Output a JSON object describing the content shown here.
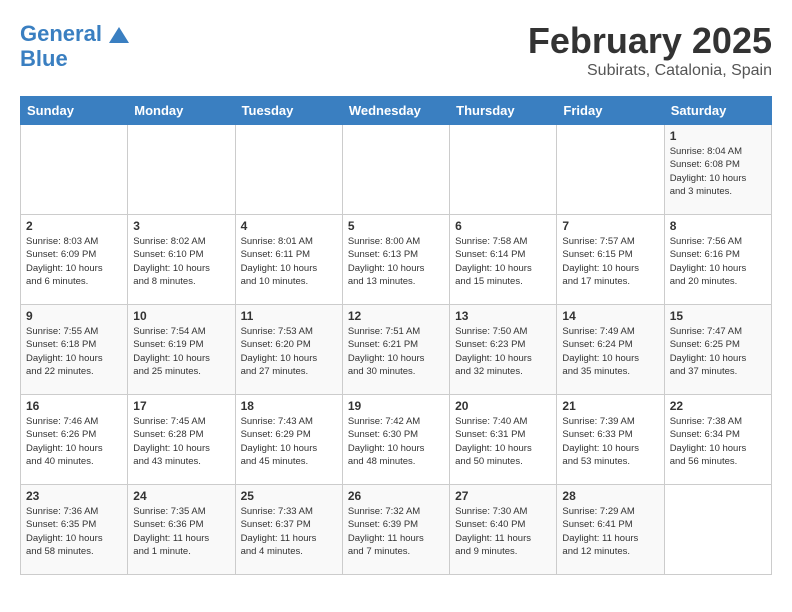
{
  "header": {
    "logo_line1": "General",
    "logo_line2": "Blue",
    "month": "February 2025",
    "location": "Subirats, Catalonia, Spain"
  },
  "weekdays": [
    "Sunday",
    "Monday",
    "Tuesday",
    "Wednesday",
    "Thursday",
    "Friday",
    "Saturday"
  ],
  "weeks": [
    [
      {
        "day": "",
        "info": ""
      },
      {
        "day": "",
        "info": ""
      },
      {
        "day": "",
        "info": ""
      },
      {
        "day": "",
        "info": ""
      },
      {
        "day": "",
        "info": ""
      },
      {
        "day": "",
        "info": ""
      },
      {
        "day": "1",
        "info": "Sunrise: 8:04 AM\nSunset: 6:08 PM\nDaylight: 10 hours\nand 3 minutes."
      }
    ],
    [
      {
        "day": "2",
        "info": "Sunrise: 8:03 AM\nSunset: 6:09 PM\nDaylight: 10 hours\nand 6 minutes."
      },
      {
        "day": "3",
        "info": "Sunrise: 8:02 AM\nSunset: 6:10 PM\nDaylight: 10 hours\nand 8 minutes."
      },
      {
        "day": "4",
        "info": "Sunrise: 8:01 AM\nSunset: 6:11 PM\nDaylight: 10 hours\nand 10 minutes."
      },
      {
        "day": "5",
        "info": "Sunrise: 8:00 AM\nSunset: 6:13 PM\nDaylight: 10 hours\nand 13 minutes."
      },
      {
        "day": "6",
        "info": "Sunrise: 7:58 AM\nSunset: 6:14 PM\nDaylight: 10 hours\nand 15 minutes."
      },
      {
        "day": "7",
        "info": "Sunrise: 7:57 AM\nSunset: 6:15 PM\nDaylight: 10 hours\nand 17 minutes."
      },
      {
        "day": "8",
        "info": "Sunrise: 7:56 AM\nSunset: 6:16 PM\nDaylight: 10 hours\nand 20 minutes."
      }
    ],
    [
      {
        "day": "9",
        "info": "Sunrise: 7:55 AM\nSunset: 6:18 PM\nDaylight: 10 hours\nand 22 minutes."
      },
      {
        "day": "10",
        "info": "Sunrise: 7:54 AM\nSunset: 6:19 PM\nDaylight: 10 hours\nand 25 minutes."
      },
      {
        "day": "11",
        "info": "Sunrise: 7:53 AM\nSunset: 6:20 PM\nDaylight: 10 hours\nand 27 minutes."
      },
      {
        "day": "12",
        "info": "Sunrise: 7:51 AM\nSunset: 6:21 PM\nDaylight: 10 hours\nand 30 minutes."
      },
      {
        "day": "13",
        "info": "Sunrise: 7:50 AM\nSunset: 6:23 PM\nDaylight: 10 hours\nand 32 minutes."
      },
      {
        "day": "14",
        "info": "Sunrise: 7:49 AM\nSunset: 6:24 PM\nDaylight: 10 hours\nand 35 minutes."
      },
      {
        "day": "15",
        "info": "Sunrise: 7:47 AM\nSunset: 6:25 PM\nDaylight: 10 hours\nand 37 minutes."
      }
    ],
    [
      {
        "day": "16",
        "info": "Sunrise: 7:46 AM\nSunset: 6:26 PM\nDaylight: 10 hours\nand 40 minutes."
      },
      {
        "day": "17",
        "info": "Sunrise: 7:45 AM\nSunset: 6:28 PM\nDaylight: 10 hours\nand 43 minutes."
      },
      {
        "day": "18",
        "info": "Sunrise: 7:43 AM\nSunset: 6:29 PM\nDaylight: 10 hours\nand 45 minutes."
      },
      {
        "day": "19",
        "info": "Sunrise: 7:42 AM\nSunset: 6:30 PM\nDaylight: 10 hours\nand 48 minutes."
      },
      {
        "day": "20",
        "info": "Sunrise: 7:40 AM\nSunset: 6:31 PM\nDaylight: 10 hours\nand 50 minutes."
      },
      {
        "day": "21",
        "info": "Sunrise: 7:39 AM\nSunset: 6:33 PM\nDaylight: 10 hours\nand 53 minutes."
      },
      {
        "day": "22",
        "info": "Sunrise: 7:38 AM\nSunset: 6:34 PM\nDaylight: 10 hours\nand 56 minutes."
      }
    ],
    [
      {
        "day": "23",
        "info": "Sunrise: 7:36 AM\nSunset: 6:35 PM\nDaylight: 10 hours\nand 58 minutes."
      },
      {
        "day": "24",
        "info": "Sunrise: 7:35 AM\nSunset: 6:36 PM\nDaylight: 11 hours\nand 1 minute."
      },
      {
        "day": "25",
        "info": "Sunrise: 7:33 AM\nSunset: 6:37 PM\nDaylight: 11 hours\nand 4 minutes."
      },
      {
        "day": "26",
        "info": "Sunrise: 7:32 AM\nSunset: 6:39 PM\nDaylight: 11 hours\nand 7 minutes."
      },
      {
        "day": "27",
        "info": "Sunrise: 7:30 AM\nSunset: 6:40 PM\nDaylight: 11 hours\nand 9 minutes."
      },
      {
        "day": "28",
        "info": "Sunrise: 7:29 AM\nSunset: 6:41 PM\nDaylight: 11 hours\nand 12 minutes."
      },
      {
        "day": "",
        "info": ""
      }
    ]
  ]
}
